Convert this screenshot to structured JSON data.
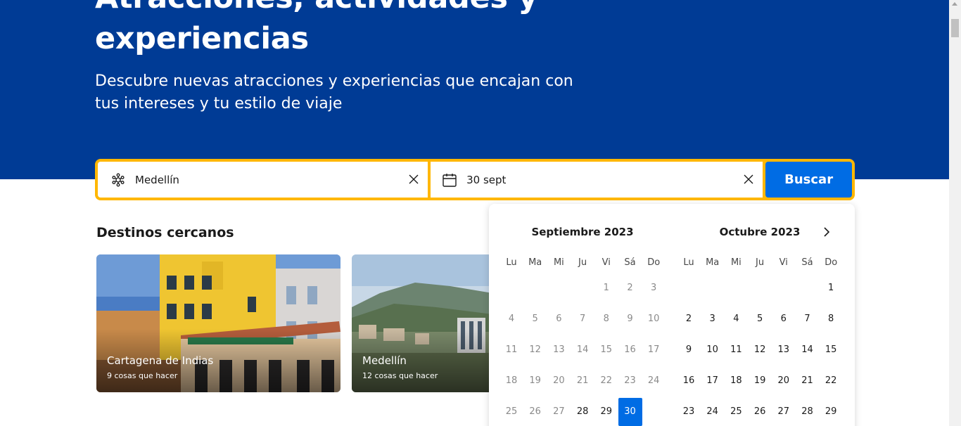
{
  "hero": {
    "title": "Atracciones, actividades y experiencias",
    "subtitle": "Descubre nuevas atracciones y experiencias que encajan con tus intereses y tu estilo de viaje"
  },
  "search": {
    "destination_value": "Medellín",
    "date_value": "30 sept",
    "button_label": "Buscar"
  },
  "nearby": {
    "title": "Destinos cercanos",
    "cards": [
      {
        "name": "Cartagena de Indias",
        "count": "9 cosas que hacer"
      },
      {
        "name": "Medellín",
        "count": "12 cosas que hacer"
      }
    ]
  },
  "calendar": {
    "weekdays": [
      "Lu",
      "Ma",
      "Mi",
      "Ju",
      "Vi",
      "Sá",
      "Do"
    ],
    "months": [
      {
        "title": "Septiembre 2023",
        "first_weekday_index": 4,
        "visible_days": 30,
        "selected_day": 30,
        "last_past_day": 27
      },
      {
        "title": "Octubre 2023",
        "first_weekday_index": 6,
        "visible_days": 29,
        "selected_day": null,
        "last_past_day": 0
      }
    ]
  },
  "colors": {
    "hero_bg": "#003b95",
    "search_border": "#ffb700",
    "primary_button": "#006ce4"
  }
}
